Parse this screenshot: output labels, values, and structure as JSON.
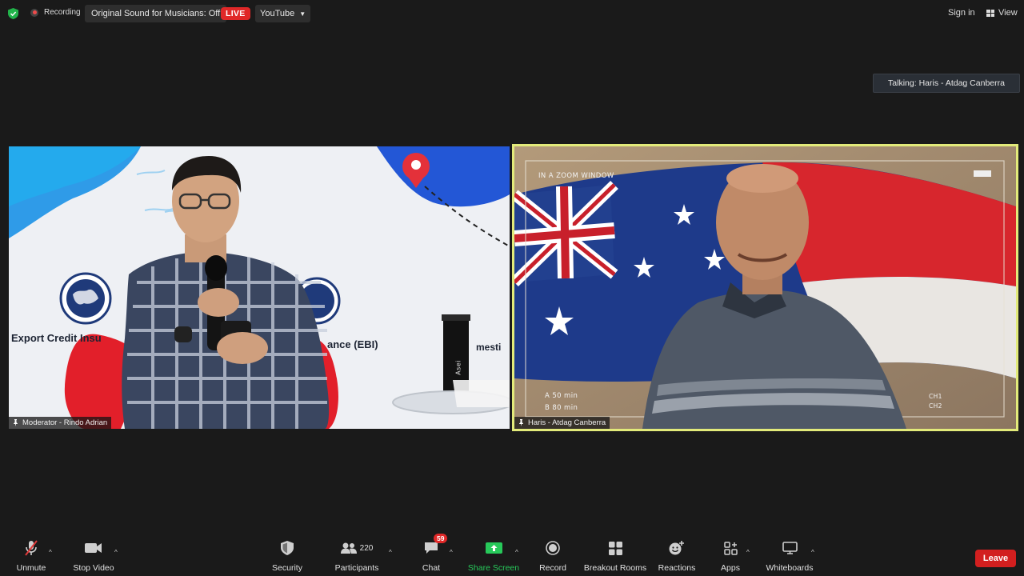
{
  "topbar": {
    "recording_label": "Recording",
    "original_sound_label": "Original Sound for Musicians: Off",
    "live_label": "LIVE",
    "youtube_label": "YouTube",
    "signin_label": "Sign in",
    "view_label": "View"
  },
  "talking_indicator": "Talking: Haris - Atdag Canberra",
  "videos": [
    {
      "name": "Moderator - Rindo Adrian",
      "banner_left": "Export Credit Insu",
      "banner_right": "ance (EBI)",
      "banner_far_right": "mesti",
      "bottle_text": "Asei"
    },
    {
      "name": "Haris - Atdag Canberra",
      "overlay_title": "IN A ZOOM WINDOW",
      "overlay_a": "A  50 min",
      "overlay_b": "B  80 min",
      "overlay_ch1": "CH1",
      "overlay_ch2": "CH2"
    }
  ],
  "toolbar": {
    "unmute": "Unmute",
    "stop_video": "Stop Video",
    "security": "Security",
    "participants": "Participants",
    "participants_count": "220",
    "chat": "Chat",
    "chat_badge": "59",
    "share_screen": "Share Screen",
    "record": "Record",
    "breakout_rooms": "Breakout Rooms",
    "reactions": "Reactions",
    "apps": "Apps",
    "whiteboards": "Whiteboards",
    "leave": "Leave"
  },
  "colors": {
    "background": "#1a1a1a",
    "active_speaker_border": "#e2ea7a",
    "live_red": "#e02828",
    "share_green": "#27c95a",
    "leave_red": "#d21f1f"
  }
}
